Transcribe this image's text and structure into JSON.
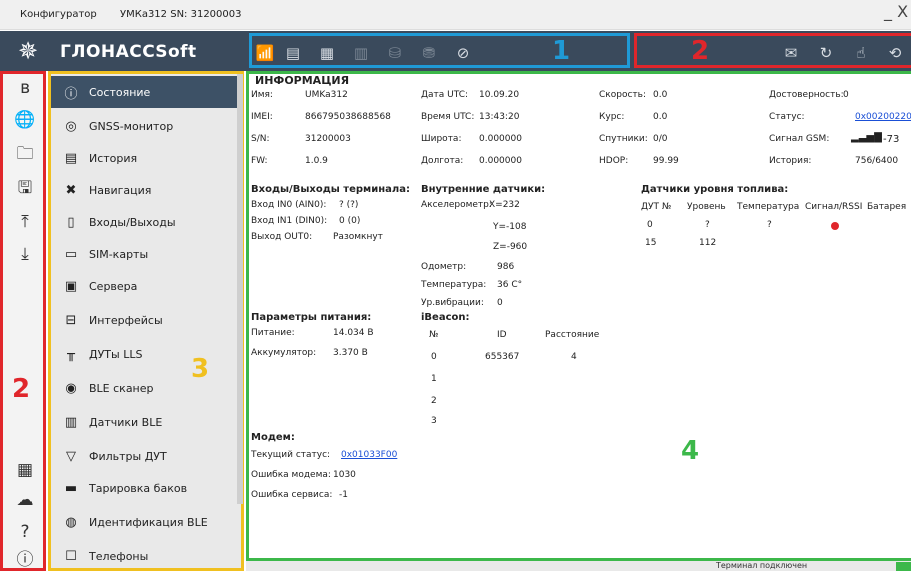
{
  "window": {
    "title": "Конфигуратор",
    "device": "УМКа312 SN: 31200003",
    "minimize": "_ X"
  },
  "logo": {
    "mark": "✵",
    "name": "ГЛОНАССSoft"
  },
  "numbers": {
    "n1": "1",
    "n2a": "2",
    "n2b": "2",
    "n3": "3",
    "n4": "4"
  },
  "toolbar1": [
    "wifi-tower-icon",
    "device-load-icon",
    "device-save-icon",
    "device-disabled-icon",
    "db-icon",
    "db-settings-icon",
    "location-off-icon"
  ],
  "toolbar2": [
    "mail-icon",
    "refresh-doc-icon",
    "hand-doc-icon",
    "play-back-icon"
  ],
  "sidebar_icons": [
    "bluetooth-icon",
    "globe-settings-icon",
    "folder-icon",
    "floppy-icon",
    "upload-icon",
    "download-icon",
    "grid-icon",
    "cloud-icon",
    "help-icon",
    "info-icon"
  ],
  "menu": [
    {
      "label": "Состояние",
      "icon": "ⓘ",
      "active": true
    },
    {
      "label": "GNSS-монитор",
      "icon": "◎"
    },
    {
      "label": "История",
      "icon": "▤"
    },
    {
      "label": "Навигация",
      "icon": "✖"
    },
    {
      "label": "Входы/Выходы",
      "icon": "▯"
    },
    {
      "label": "SIM-карты",
      "icon": "▭"
    },
    {
      "label": "Сервера",
      "icon": "▣"
    },
    {
      "label": "Интерфейсы",
      "icon": "⊟"
    },
    {
      "label": "ДУТы LLS",
      "icon": "╥"
    },
    {
      "label": "BLE сканер",
      "icon": "◉"
    },
    {
      "label": "Датчики BLE",
      "icon": "▥"
    },
    {
      "label": "Фильтры ДУТ",
      "icon": "▽"
    },
    {
      "label": "Тарировка баков",
      "icon": "▬"
    },
    {
      "label": "Идентификация BLE",
      "icon": "◍"
    },
    {
      "label": "Телефоны",
      "icon": "☐"
    }
  ],
  "info": {
    "title": "ИНФОРМАЦИЯ",
    "imya_l": "Имя:",
    "imya": "UMKa312",
    "imei_l": "IMEI:",
    "imei": "866795038688568",
    "sn_l": "S/N:",
    "sn": "31200003",
    "fw_l": "FW:",
    "fw": "1.0.9",
    "date_l": "Дата UTC:",
    "date": "10.09.20",
    "time_l": "Время UTC:",
    "time": "13:43:20",
    "lat_l": "Широта:",
    "lat": "0.000000",
    "lon_l": "Долгота:",
    "lon": "0.000000",
    "speed_l": "Скорость:",
    "speed": "0.0",
    "course_l": "Курс:",
    "course": "0.0",
    "sat_l": "Спутники:",
    "sat": "0/0",
    "hdop_l": "HDOP:",
    "hdop": "99.99",
    "valid_l": "Достоверность:",
    "valid": "0",
    "status_l": "Статус:",
    "status": "0x00200220",
    "gsm_l": "Сигнал GSM:",
    "gsm": "-73",
    "gsm_icon": "▂▃▅▇",
    "hist_l": "История:",
    "hist": "756/6400"
  },
  "io": {
    "title": "Входы/Выходы терминала:",
    "in0_l": "Вход IN0 (AIN0):",
    "in0": "? (?)",
    "in1_l": "Вход IN1 (DIN0):",
    "in1": "0 (0)",
    "out0_l": "Выход OUT0:",
    "out0": "Разомкнут"
  },
  "sensors": {
    "title": "Внутренние датчики:",
    "accel_l": "Акселерометр:",
    "x": "X=232",
    "y": "Y=-108",
    "z": "Z=-960",
    "odo_l": "Одометр:",
    "odo": "986",
    "temp_l": "Температура:",
    "temp": "36 C°",
    "vib_l": "Ур.вибрации:",
    "vib": "0"
  },
  "fuel": {
    "title": "Датчики уровня топлива:",
    "h1": "ДУТ №",
    "h2": "Уровень",
    "h3": "Температура",
    "h4": "Сигнал/RSSI",
    "h5": "Батарея",
    "r1c1": "0",
    "r1c2": "?",
    "r1c3": "?",
    "r2c1": "15",
    "r2c2": "112"
  },
  "power": {
    "title": "Параметры питания:",
    "pit_l": "Питание:",
    "pit": "14.034 В",
    "akk_l": "Аккумулятор:",
    "akk": "3.370 В"
  },
  "ibeacon": {
    "title": "iBeacon:",
    "h1": "№",
    "h2": "ID",
    "h3": "Расстояние",
    "r0": "0",
    "r0id": "655367",
    "r0d": "4",
    "r1": "1",
    "r2": "2",
    "r3": "3"
  },
  "modem": {
    "title": "Модем:",
    "cur_l": "Текущий статус:",
    "cur": "0x01033F00",
    "err_l": "Ошибка модема:",
    "err": "1030",
    "srv_l": "Ошибка сервиса:",
    "srv": "-1"
  },
  "status": {
    "text": "Терминал подключен"
  }
}
